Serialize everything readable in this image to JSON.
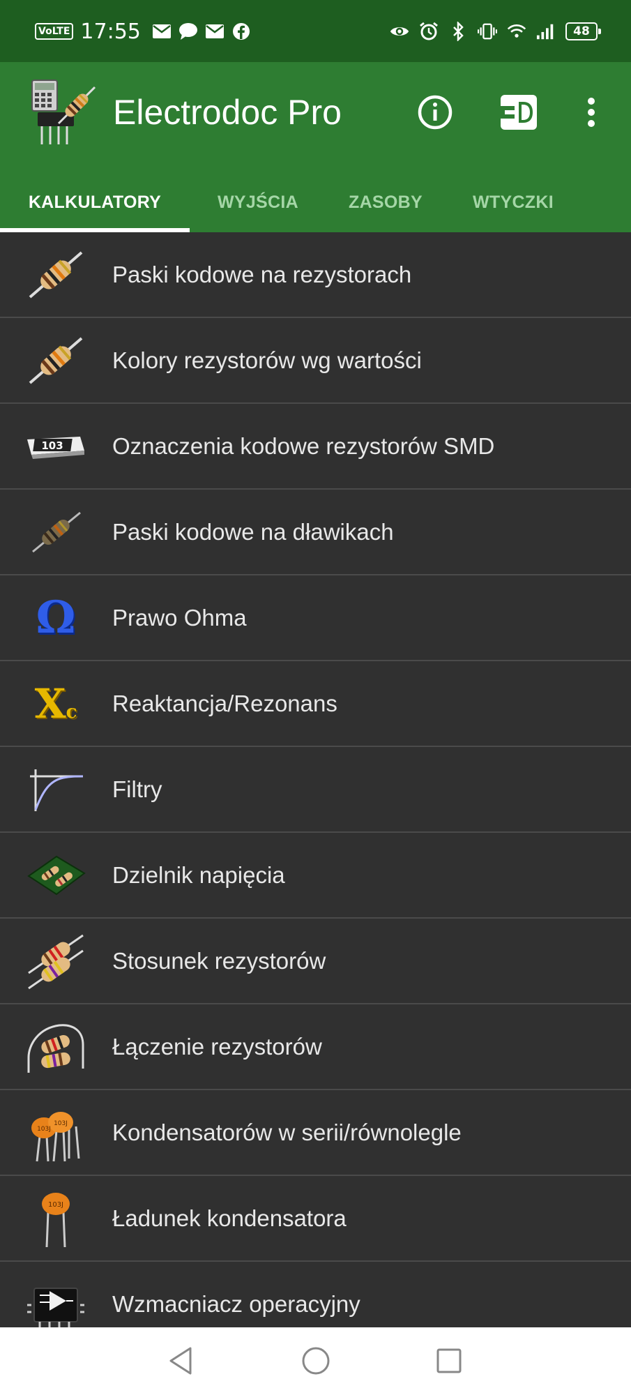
{
  "status_bar": {
    "volte": "VoLTE",
    "time": "17:55",
    "battery": "48",
    "left_icons": [
      "mail-icon",
      "chat-icon",
      "mail-icon",
      "facebook-icon"
    ],
    "right_icons": [
      "eye-icon",
      "alarm-icon",
      "bluetooth-icon",
      "vibrate-icon",
      "wifi-icon",
      "signal-icon"
    ]
  },
  "app_bar": {
    "title": "Electrodoc Pro",
    "actions": [
      "info-icon",
      "plug-icon",
      "more-vert-icon"
    ]
  },
  "tabs": [
    {
      "label": "KALKULATORY",
      "active": true
    },
    {
      "label": "WYJŚCIA",
      "active": false
    },
    {
      "label": "ZASOBY",
      "active": false
    },
    {
      "label": "WTYCZKI",
      "active": false
    }
  ],
  "list": {
    "items": [
      {
        "label": "Paski kodowe na rezystorach",
        "icon": "resistor-icon"
      },
      {
        "label": "Kolory rezystorów wg wartości",
        "icon": "resistor-icon"
      },
      {
        "label": "Oznaczenia kodowe rezystorów SMD",
        "icon": "smd-resistor-icon",
        "icon_text": "103"
      },
      {
        "label": "Paski kodowe na dławikach",
        "icon": "inductor-icon"
      },
      {
        "label": "Prawo Ohma",
        "icon": "omega-icon",
        "icon_text": "Ω"
      },
      {
        "label": "Reaktancja/Rezonans",
        "icon": "reactance-icon",
        "icon_text": "X",
        "icon_sub": "c"
      },
      {
        "label": "Filtry",
        "icon": "filter-curve-icon"
      },
      {
        "label": "Dzielnik napięcia",
        "icon": "voltage-divider-icon"
      },
      {
        "label": "Stosunek rezystorów",
        "icon": "resistor-pair-icon"
      },
      {
        "label": "Łączenie rezystorów",
        "icon": "resistor-network-icon"
      },
      {
        "label": "Kondensatorów w serii/równolegle",
        "icon": "capacitors-icon",
        "icon_text": "103J"
      },
      {
        "label": "Ładunek kondensatora",
        "icon": "capacitor-icon",
        "icon_text": "103J"
      },
      {
        "label": "Wzmacniacz operacyjny",
        "icon": "op-amp-icon"
      }
    ]
  },
  "nav_bar": {
    "buttons": [
      "back-icon",
      "home-icon",
      "recents-icon"
    ]
  },
  "colors": {
    "status_bar": "#1e5e20",
    "app_bar": "#2e7d32",
    "list_bg": "#303030",
    "divider": "#4a4a4a",
    "tab_inactive": "#a5d6a7",
    "text": "#e8e8e8"
  }
}
